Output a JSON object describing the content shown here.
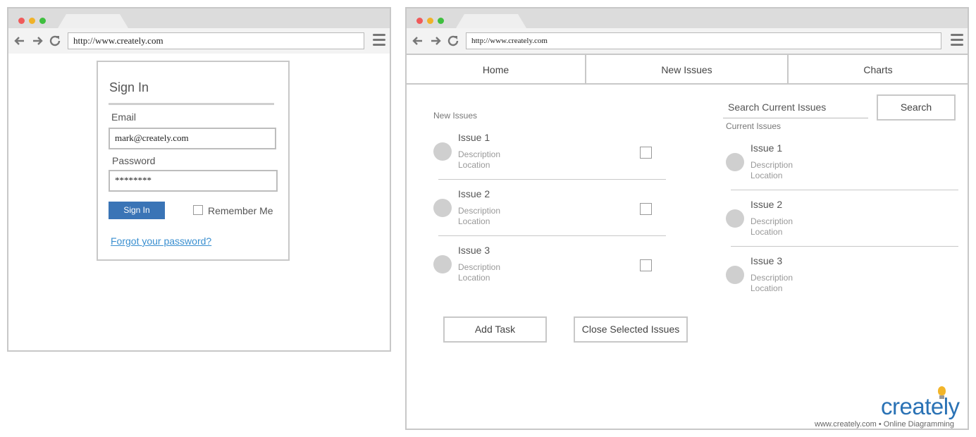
{
  "left_window": {
    "url": "http://www.creately.com",
    "signin": {
      "title": "Sign In",
      "email_label": "Email",
      "email_value": "mark@creately.com",
      "password_label": "Password",
      "password_value": "********",
      "submit_label": "Sign In",
      "remember_label": "Remember Me",
      "forgot_label": "Forgot your password?"
    }
  },
  "right_window": {
    "url": "http://www.creately.com",
    "nav": [
      "Home",
      "New Issues",
      "Charts"
    ],
    "new_issues": {
      "heading": "New Issues",
      "items": [
        {
          "title": "Issue 1",
          "description": "Description",
          "location": "Location"
        },
        {
          "title": "Issue 2",
          "description": "Description",
          "location": "Location"
        },
        {
          "title": "Issue 3",
          "description": "Description",
          "location": "Location"
        }
      ]
    },
    "current_issues": {
      "search_placeholder": "Search Current Issues",
      "search_button": "Search",
      "heading": "Current Issues",
      "items": [
        {
          "title": "Issue 1",
          "description": "Description",
          "location": "Location"
        },
        {
          "title": "Issue 2",
          "description": "Description",
          "location": "Location"
        },
        {
          "title": "Issue 3",
          "description": "Description",
          "location": "Location"
        }
      ]
    },
    "actions": {
      "add_task": "Add Task",
      "close_selected": "Close Selected Issues"
    }
  },
  "watermark": {
    "brand": "creately",
    "tagline": "www.creately.com • Online Diagramming",
    "brand_color": "#2a72b5"
  },
  "colors": {
    "primary_button": "#3a74b6",
    "link": "#3a8fd0",
    "traffic_red": "#f05a5a",
    "traffic_yellow": "#f0b228",
    "traffic_green": "#3fbf3f"
  }
}
